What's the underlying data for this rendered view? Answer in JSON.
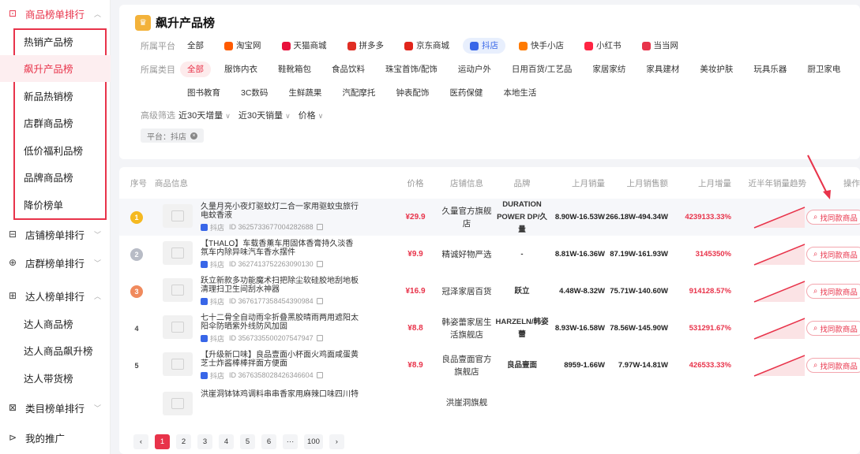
{
  "sidebar": {
    "sections": [
      {
        "label": "商品榜单排行",
        "icon": "circle-icon"
      },
      {
        "label": "店铺榜单排行",
        "icon": "shop-icon"
      },
      {
        "label": "店群榜单排行",
        "icon": "shop-group-icon"
      },
      {
        "label": "达人榜单排行",
        "icon": "person-icon"
      },
      {
        "label": "类目榜单排行",
        "icon": "category-icon"
      },
      {
        "label": "我的推广",
        "icon": "share-icon"
      }
    ],
    "goods_items": [
      "热销产品榜",
      "飙升产品榜",
      "新品热销榜",
      "店群商品榜",
      "低价福利品榜",
      "品牌商品榜",
      "降价榜单"
    ],
    "talent_items": [
      "达人商品榜",
      "达人商品飙升榜",
      "达人带货榜"
    ]
  },
  "page": {
    "title": "飙升产品榜"
  },
  "filters": {
    "platform_label": "所属平台",
    "platforms": [
      {
        "label": "全部",
        "color": ""
      },
      {
        "label": "淘宝网",
        "color": "#ff5a00"
      },
      {
        "label": "天猫商城",
        "color": "#e8103b"
      },
      {
        "label": "拼多多",
        "color": "#e02e24"
      },
      {
        "label": "京东商城",
        "color": "#e1251b"
      },
      {
        "label": "抖店",
        "color": "#3866e8"
      },
      {
        "label": "快手小店",
        "color": "#ff7a00"
      },
      {
        "label": "小红书",
        "color": "#ff2442"
      },
      {
        "label": "当当网",
        "color": "#e8334a"
      }
    ],
    "category_label": "所属类目",
    "categories_row1": [
      "全部",
      "服饰内衣",
      "鞋靴箱包",
      "食品饮料",
      "珠宝首饰/配饰",
      "运动户外",
      "日用百货/工艺品",
      "家居家纺",
      "家具建材",
      "美妆护肤",
      "玩具乐器",
      "厨卫家电"
    ],
    "categories_row2": [
      "图书教育",
      "3C数码",
      "生鲜蔬果",
      "汽配摩托",
      "钟表配饰",
      "医药保健",
      "本地生活"
    ],
    "advanced_label": "高级筛选",
    "advanced": [
      "近30天增量",
      "近30天销量",
      "价格"
    ],
    "active_tag": "平台：抖店"
  },
  "table": {
    "headers": {
      "idx": "序号",
      "info": "商品信息",
      "price": "价格",
      "shop": "店铺信息",
      "brand": "品牌",
      "vol": "上月销量",
      "amt": "上月销售额",
      "inc": "上月增量",
      "trend": "近半年销量趋势",
      "op": "操作"
    },
    "platform_tag": "抖店",
    "action_label": "找同款商品",
    "rows": [
      {
        "rank": "1",
        "rank_color": "#f5b921",
        "title": "久量月亮小夜灯驱蚊灯二合一家用驱蚊虫旅行电蚊香液",
        "id": "ID 3625733677004282688",
        "price": "¥29.9",
        "shop": "久量官方旗舰店",
        "brand": "DURATION POWER DP/久量",
        "vol": "8.90W-16.53W",
        "amt": "266.18W-494.34W",
        "inc": "4239133.33%"
      },
      {
        "rank": "2",
        "rank_color": "#b8bcc6",
        "title": "【THALO】车载香薰车用固体香膏持久淡香氛车内除异味汽车香水摆件",
        "id": "ID 3627413752263090130",
        "price": "¥9.9",
        "shop": "精诚好物严选",
        "brand": "-",
        "vol": "8.81W-16.36W",
        "amt": "87.19W-161.93W",
        "inc": "3145350%"
      },
      {
        "rank": "3",
        "rank_color": "#f08a5d",
        "title": "跃立新款多功能魔术扫把除尘软硅胶地刮地板清理扫卫生间刮水神器",
        "id": "ID 3676177358454390984",
        "price": "¥16.9",
        "shop": "冠泽家居百货",
        "brand": "跃立",
        "vol": "4.48W-8.32W",
        "amt": "75.71W-140.60W",
        "inc": "914128.57%"
      },
      {
        "rank": "4",
        "rank_color": "",
        "title": "七十二骨全自动雨伞折叠黑胶晴雨两用遮阳太阳伞防晒紫外线防风加固",
        "id": "ID 3567335500207547947",
        "price": "¥8.8",
        "shop": "韩姿蕾家居生活旗舰店",
        "brand": "HARZELN/韩姿蕾",
        "vol": "8.93W-16.58W",
        "amt": "78.56W-145.90W",
        "inc": "531291.67%"
      },
      {
        "rank": "5",
        "rank_color": "",
        "title": "【升级新口味】良品壹面小杯面火鸡面咸蛋黄芝士炸酱棒棒拌面方便面",
        "id": "ID 3676358028426346604",
        "price": "¥8.9",
        "shop": "良品壹面官方旗舰店",
        "brand": "良品壹面",
        "vol": "8959-1.66W",
        "amt": "7.97W-14.81W",
        "inc": "426533.33%"
      },
      {
        "rank": "",
        "rank_color": "",
        "title": "洪崖洞钵钵鸡调料串串香家用麻辣口味四川特",
        "id": "",
        "price": "",
        "shop": "洪崖洞旗舰",
        "brand": "",
        "vol": "",
        "amt": "",
        "inc": ""
      }
    ]
  },
  "pagination": {
    "pages": [
      "1",
      "2",
      "3",
      "4",
      "5",
      "6",
      "···",
      "100"
    ],
    "current": "1"
  }
}
